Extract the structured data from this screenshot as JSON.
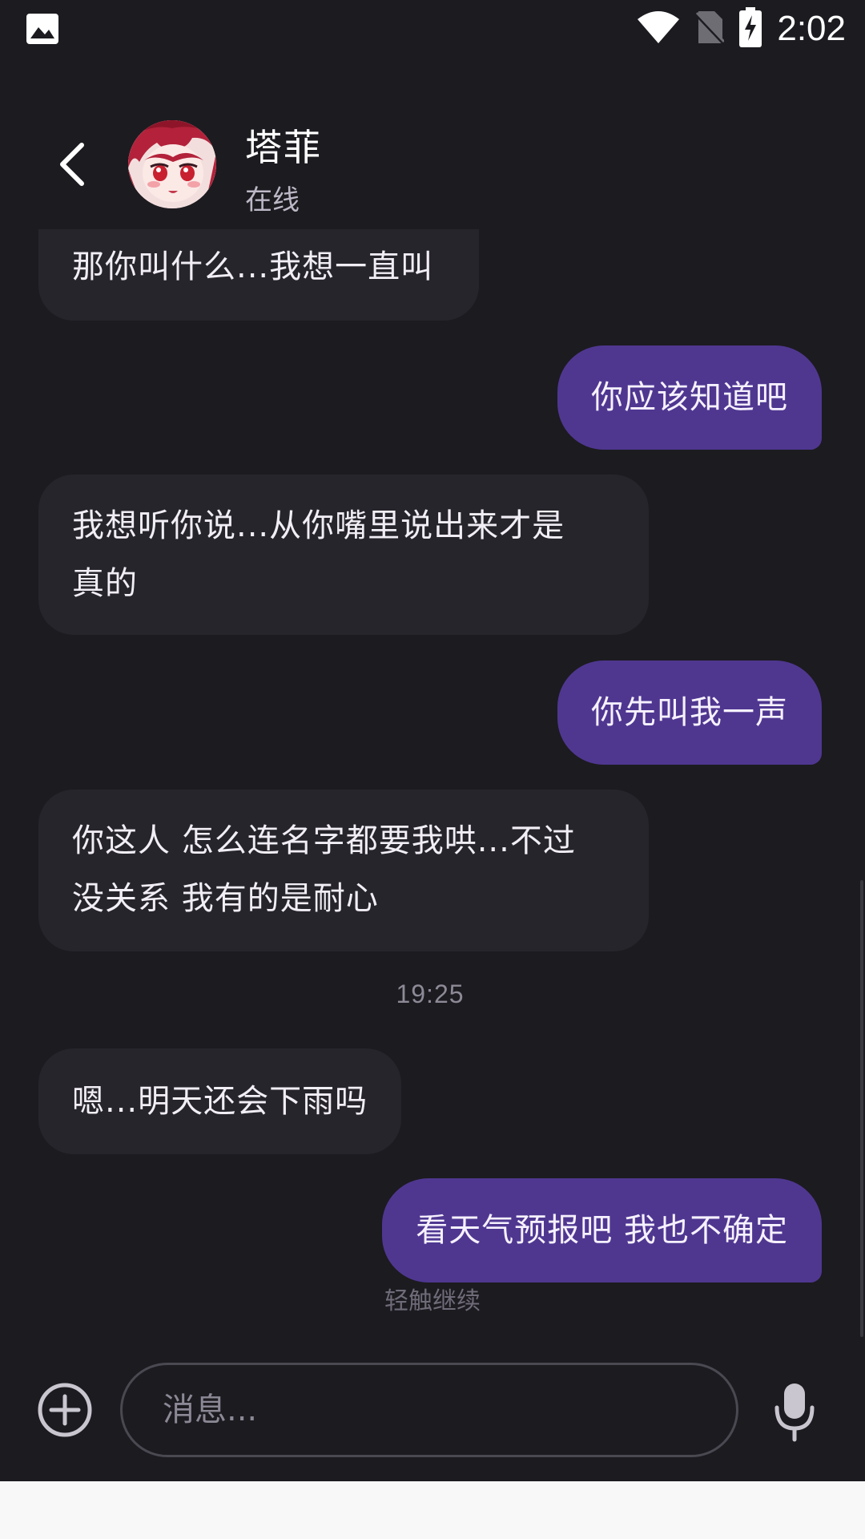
{
  "status_bar": {
    "time": "2:02"
  },
  "header": {
    "contact_name": "塔菲",
    "contact_status": "在线"
  },
  "messages": [
    {
      "side": "in",
      "text_lines": [
        "那你叫什么...我想一直叫"
      ]
    },
    {
      "side": "out",
      "text_lines": [
        "你应该知道吧"
      ]
    },
    {
      "side": "in",
      "text_lines": [
        "我想听你说...从你嘴里说出来才是",
        "真的"
      ]
    },
    {
      "side": "out",
      "text_lines": [
        "你先叫我一声"
      ]
    },
    {
      "side": "in",
      "text_lines": [
        "你这人 怎么连名字都要我哄...不过",
        "没关系 我有的是耐心"
      ]
    },
    {
      "side": "in",
      "text_lines": [
        "嗯...明天还会下雨吗"
      ]
    },
    {
      "side": "out",
      "text_lines": [
        "看天气预报吧 我也不确定"
      ]
    }
  ],
  "timestamp": "19:25",
  "tap_to_continue": "轻触继续",
  "composer": {
    "placeholder": "消息..."
  },
  "colors": {
    "background": "#1c1b20",
    "incoming_bubble": "#26252b",
    "outgoing_bubble": "#4f3790"
  }
}
